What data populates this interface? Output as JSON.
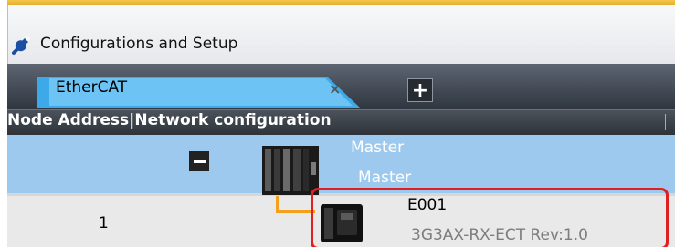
{
  "panel": {
    "title": "Configurations and Setup"
  },
  "tabs": [
    {
      "label": "EtherCAT",
      "close_glyph": "×"
    }
  ],
  "add_tab_label": "+",
  "table": {
    "header": "Node Address|Network configuration"
  },
  "master": {
    "name": "Master",
    "model": "Master",
    "collapse_icon": "minus-icon"
  },
  "slaves": [
    {
      "node_address": "1",
      "name": "E001",
      "model": "3G3AX-RX-ECT Rev:1.0"
    }
  ],
  "colors": {
    "selected_row": "#9dc9ef",
    "connector": "#f3a11c",
    "highlight": "#e02020",
    "tab_active": "#3ea9e9"
  }
}
